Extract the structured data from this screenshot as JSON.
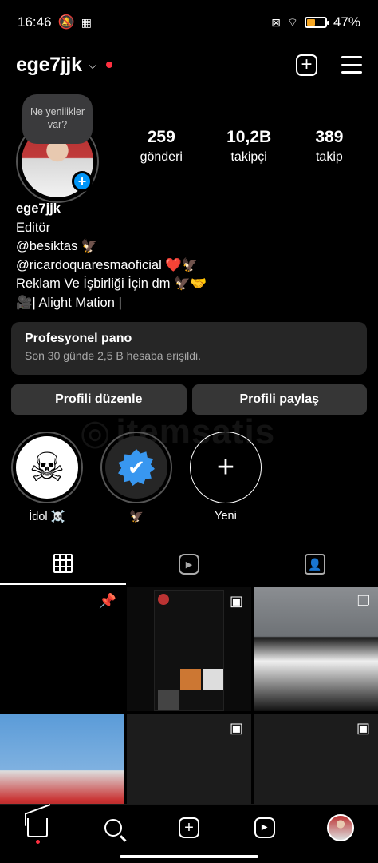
{
  "status_bar": {
    "time": "16:46",
    "battery_percent": "47%",
    "battery_level": 0.47,
    "icons": [
      "mute-icon",
      "app-icon",
      "sim-off-icon",
      "wifi-icon",
      "battery-icon"
    ]
  },
  "header": {
    "username": "ege7jjk"
  },
  "profile": {
    "note": "Ne yenilikler var?",
    "stats": [
      {
        "value": "259",
        "label": "gönderi"
      },
      {
        "value": "10,2B",
        "label": "takipçi"
      },
      {
        "value": "389",
        "label": "takip"
      }
    ],
    "bio_name": "ege7jjk",
    "bio_category": "Editör",
    "bio_lines": [
      "@besiktas 🦅",
      "@ricardoquaresmaoficial ❤️🦅",
      "Reklam Ve İşbirliği İçin dm 🦅🤝",
      "🎥| Alight Mation |"
    ]
  },
  "dashboard": {
    "title": "Profesyonel pano",
    "subtitle": "Son 30 günde 2,5 B hesaba erişildi."
  },
  "buttons": {
    "edit": "Profili düzenle",
    "share": "Profili paylaş"
  },
  "watermark": "itemsatis",
  "highlights": [
    {
      "label": "İdol ☠️",
      "icon": "☠"
    },
    {
      "label": "🦅",
      "icon": "✔"
    },
    {
      "label": "Yeni",
      "icon": "+"
    }
  ],
  "colors": {
    "accent": "#0095f6",
    "notification": "#ff3040",
    "panel": "#262626",
    "button": "#363636"
  }
}
